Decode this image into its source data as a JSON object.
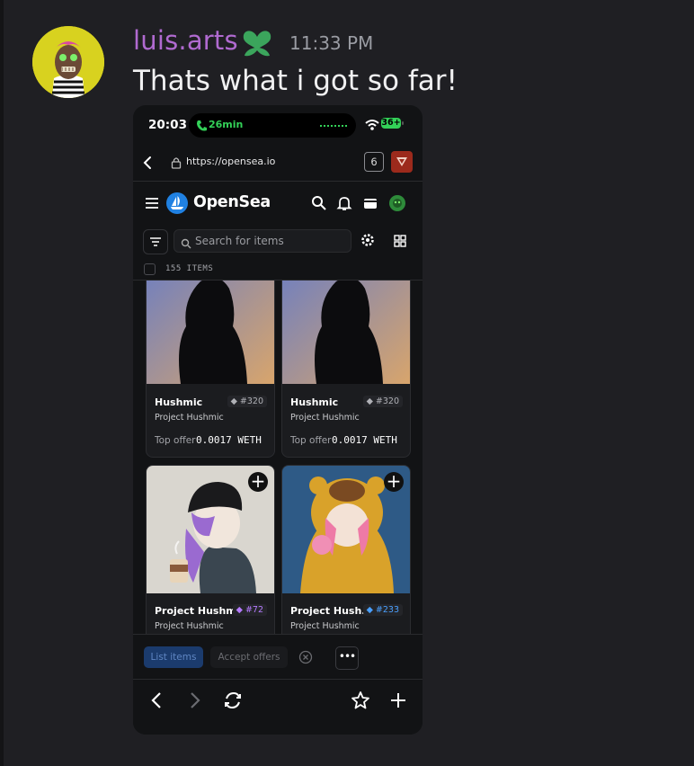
{
  "author": {
    "name": "luis.arts",
    "timestamp": "11:33 PM"
  },
  "message": {
    "text": "Thats what i got so far!"
  },
  "phone": {
    "status_bar": {
      "time": "20:03",
      "activity": "26min",
      "battery": "36+"
    },
    "browser": {
      "url": "https://opensea.io",
      "tab_count": "6"
    },
    "opensea": {
      "brand": "OpenSea",
      "search_placeholder": "Search for items",
      "items_count": "155 ITEMS",
      "cards": [
        {
          "title": "Hushmic",
          "tag": "#320",
          "collection": "Project Hushmic",
          "offer_label": "Top offer",
          "offer_value": "0.0017 WETH"
        },
        {
          "title": "Hushmic",
          "tag": "#320",
          "collection": "Project Hushmic",
          "offer_label": "Top offer",
          "offer_value": "0.0017 WETH"
        },
        {
          "title": "Project Hushm...",
          "tag": "#72",
          "collection": "Project Hushmic"
        },
        {
          "title": "Project Hush...",
          "tag": "#233",
          "collection": "Project Hushmic"
        }
      ],
      "actions": {
        "list_items": "List items",
        "accept_offers": "Accept offers",
        "more": "•••"
      }
    }
  },
  "colors": {
    "background": "#1f1f23",
    "username": "#b06ad0",
    "timestamp": "#9a9ca3",
    "opensea_blue": "#2081e2",
    "ios_green": "#33d158"
  },
  "icons": [
    "heart-leaf-badge-icon",
    "phone-icon",
    "wifi-icon",
    "back-icon",
    "lock-icon",
    "extension-icon",
    "menu-icon",
    "opensea-logo-icon",
    "search-icon",
    "bell-icon",
    "wallet-icon",
    "account-icon",
    "filter-icon",
    "gear-icon",
    "grid-icon",
    "add-icon",
    "close-circle-icon",
    "chevron-left-icon",
    "chevron-right-icon",
    "refresh-icon",
    "star-icon",
    "plus-icon"
  ]
}
